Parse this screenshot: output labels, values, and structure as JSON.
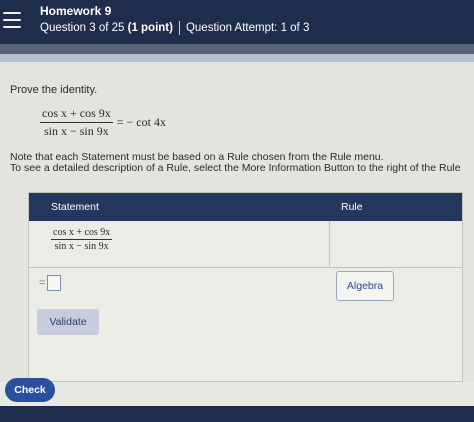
{
  "header": {
    "title": "Homework 9",
    "question_label": "Question 3 of 25",
    "points": "(1 point)",
    "attempt": "Question Attempt: 1 of 3"
  },
  "problem": {
    "prompt": "Prove the identity.",
    "lhs_numerator": "cos x + cos 9x",
    "lhs_denominator": "sin x − sin 9x",
    "rhs": "= − cot 4x",
    "note_line1": "Note that each Statement must be based on a Rule chosen from the Rule menu.",
    "note_line2": "To see a detailed description of a Rule, select the More Information Button to the right of the Rule"
  },
  "table": {
    "statement_header": "Statement",
    "rule_header": "Rule",
    "row1_numerator": "cos x + cos 9x",
    "row1_denominator": "sin x − sin 9x",
    "equals_sign": "=",
    "rule_selected": "Algebra",
    "validate_label": "Validate"
  },
  "footer": {
    "check_label": "Check"
  },
  "colors": {
    "header_bg": "#1f2d4d",
    "table_header_bg": "#25375c",
    "check_button": "#2a4f9e"
  }
}
